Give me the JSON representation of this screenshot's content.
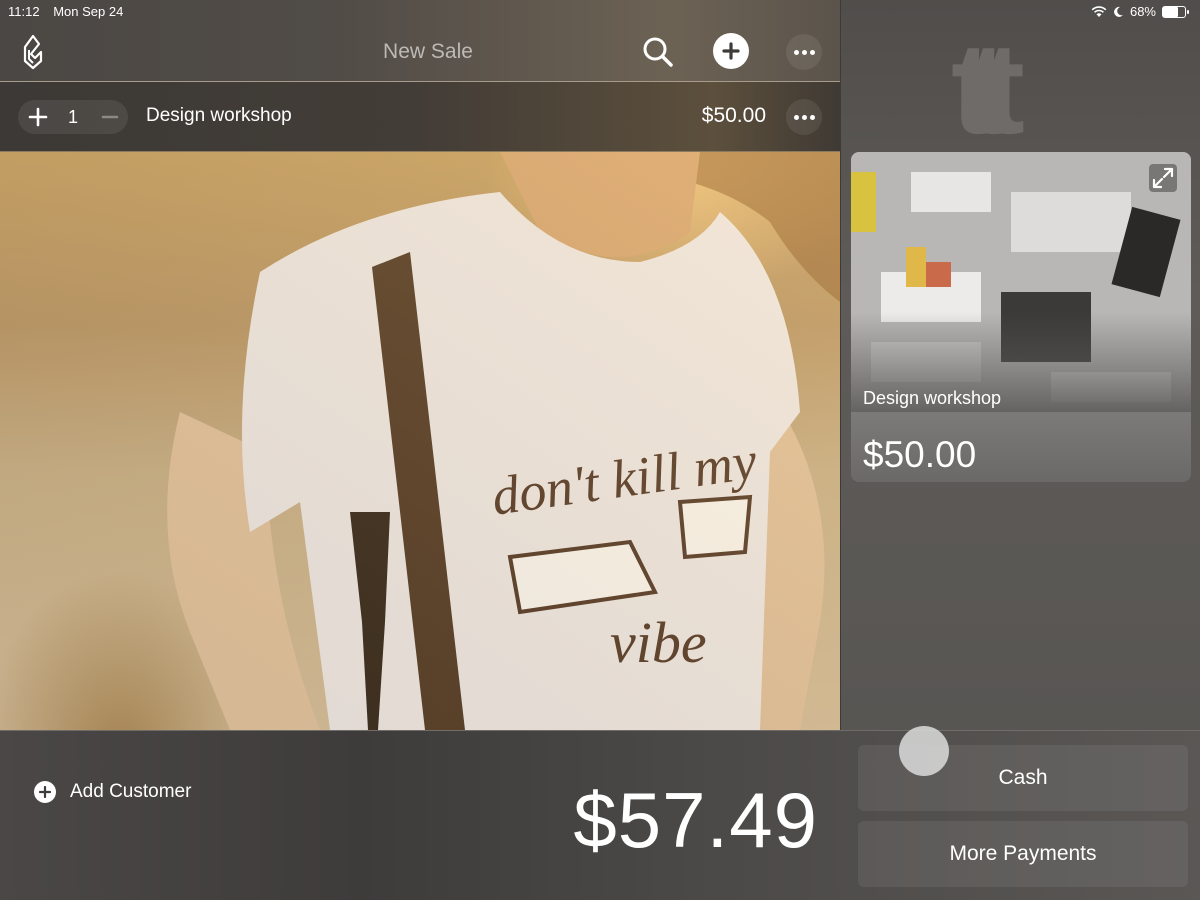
{
  "status_bar": {
    "time": "11:12",
    "date": "Mon Sep 24",
    "battery": "68%",
    "battery_level": 0.68
  },
  "header": {
    "title": "New Sale",
    "search_icon": "search-icon",
    "add_icon": "plus-circle-icon",
    "more_icon": "ellipsis-icon"
  },
  "line_item": {
    "quantity": "1",
    "name": "Design workshop",
    "price": "$50.00"
  },
  "product_tile": {
    "name": "Design workshop",
    "price": "$50.00",
    "expand_icon": "expand-icon"
  },
  "brand": {
    "logo_text": "ttt"
  },
  "footer": {
    "add_customer_label": "Add Customer",
    "total": "$57.49",
    "cash_label": "Cash",
    "more_payments_label": "More Payments"
  },
  "colors": {
    "panel_dark": "#3e3c3b",
    "panel_mid": "#5a5856",
    "accent_gold": "#a79c8c"
  }
}
